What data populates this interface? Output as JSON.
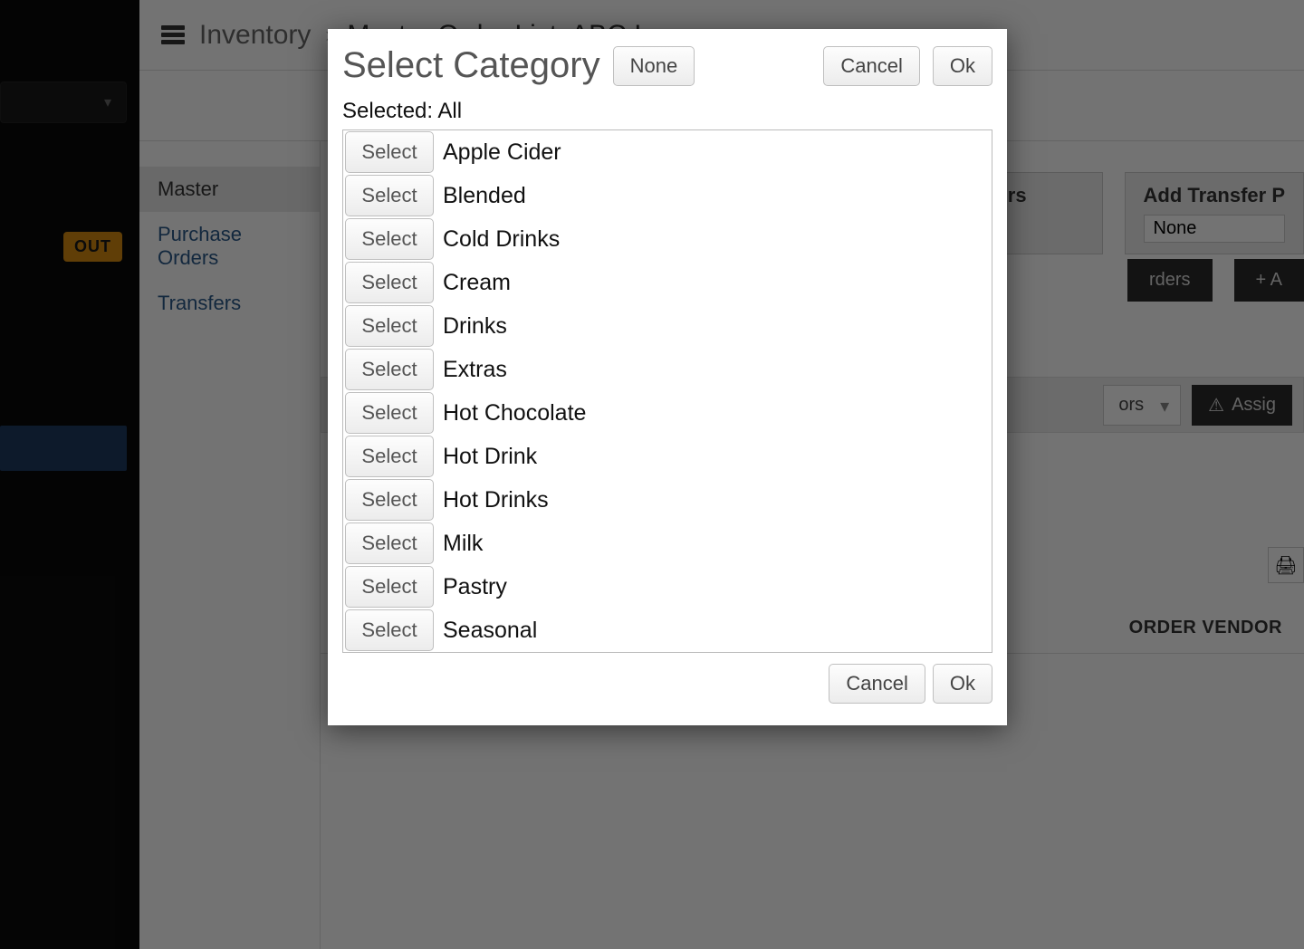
{
  "breadcrumb": {
    "root": "Inventory",
    "title": "Master Order List: ABC Inc"
  },
  "leftRail": {
    "outBadge": "OUT"
  },
  "tabs": {
    "master": "Master",
    "purchaseOrders": "Purchase Orders",
    "transfers": "Transfers"
  },
  "panels": {
    "ordersSuffix": "rders",
    "addTransfer": "Add Transfer P",
    "none": "None",
    "addPlus": "+ A"
  },
  "midBar": {
    "vendorsDropdown": "ors",
    "assignBtn": "Assig"
  },
  "tableHeader": {
    "orderVendor": "ORDER VENDOR"
  },
  "modal": {
    "title": "Select Category",
    "noneBtn": "None",
    "cancelBtn": "Cancel",
    "okBtn": "Ok",
    "selectedPrefix": "Selected: ",
    "selectedValue": "All",
    "selectBtnLabel": "Select",
    "categories": [
      "Apple Cider",
      "Blended",
      "Cold Drinks",
      "Cream",
      "Drinks",
      "Extras",
      "Hot Chocolate",
      "Hot Drink",
      "Hot Drinks",
      "Milk",
      "Pastry",
      "Seasonal"
    ]
  }
}
